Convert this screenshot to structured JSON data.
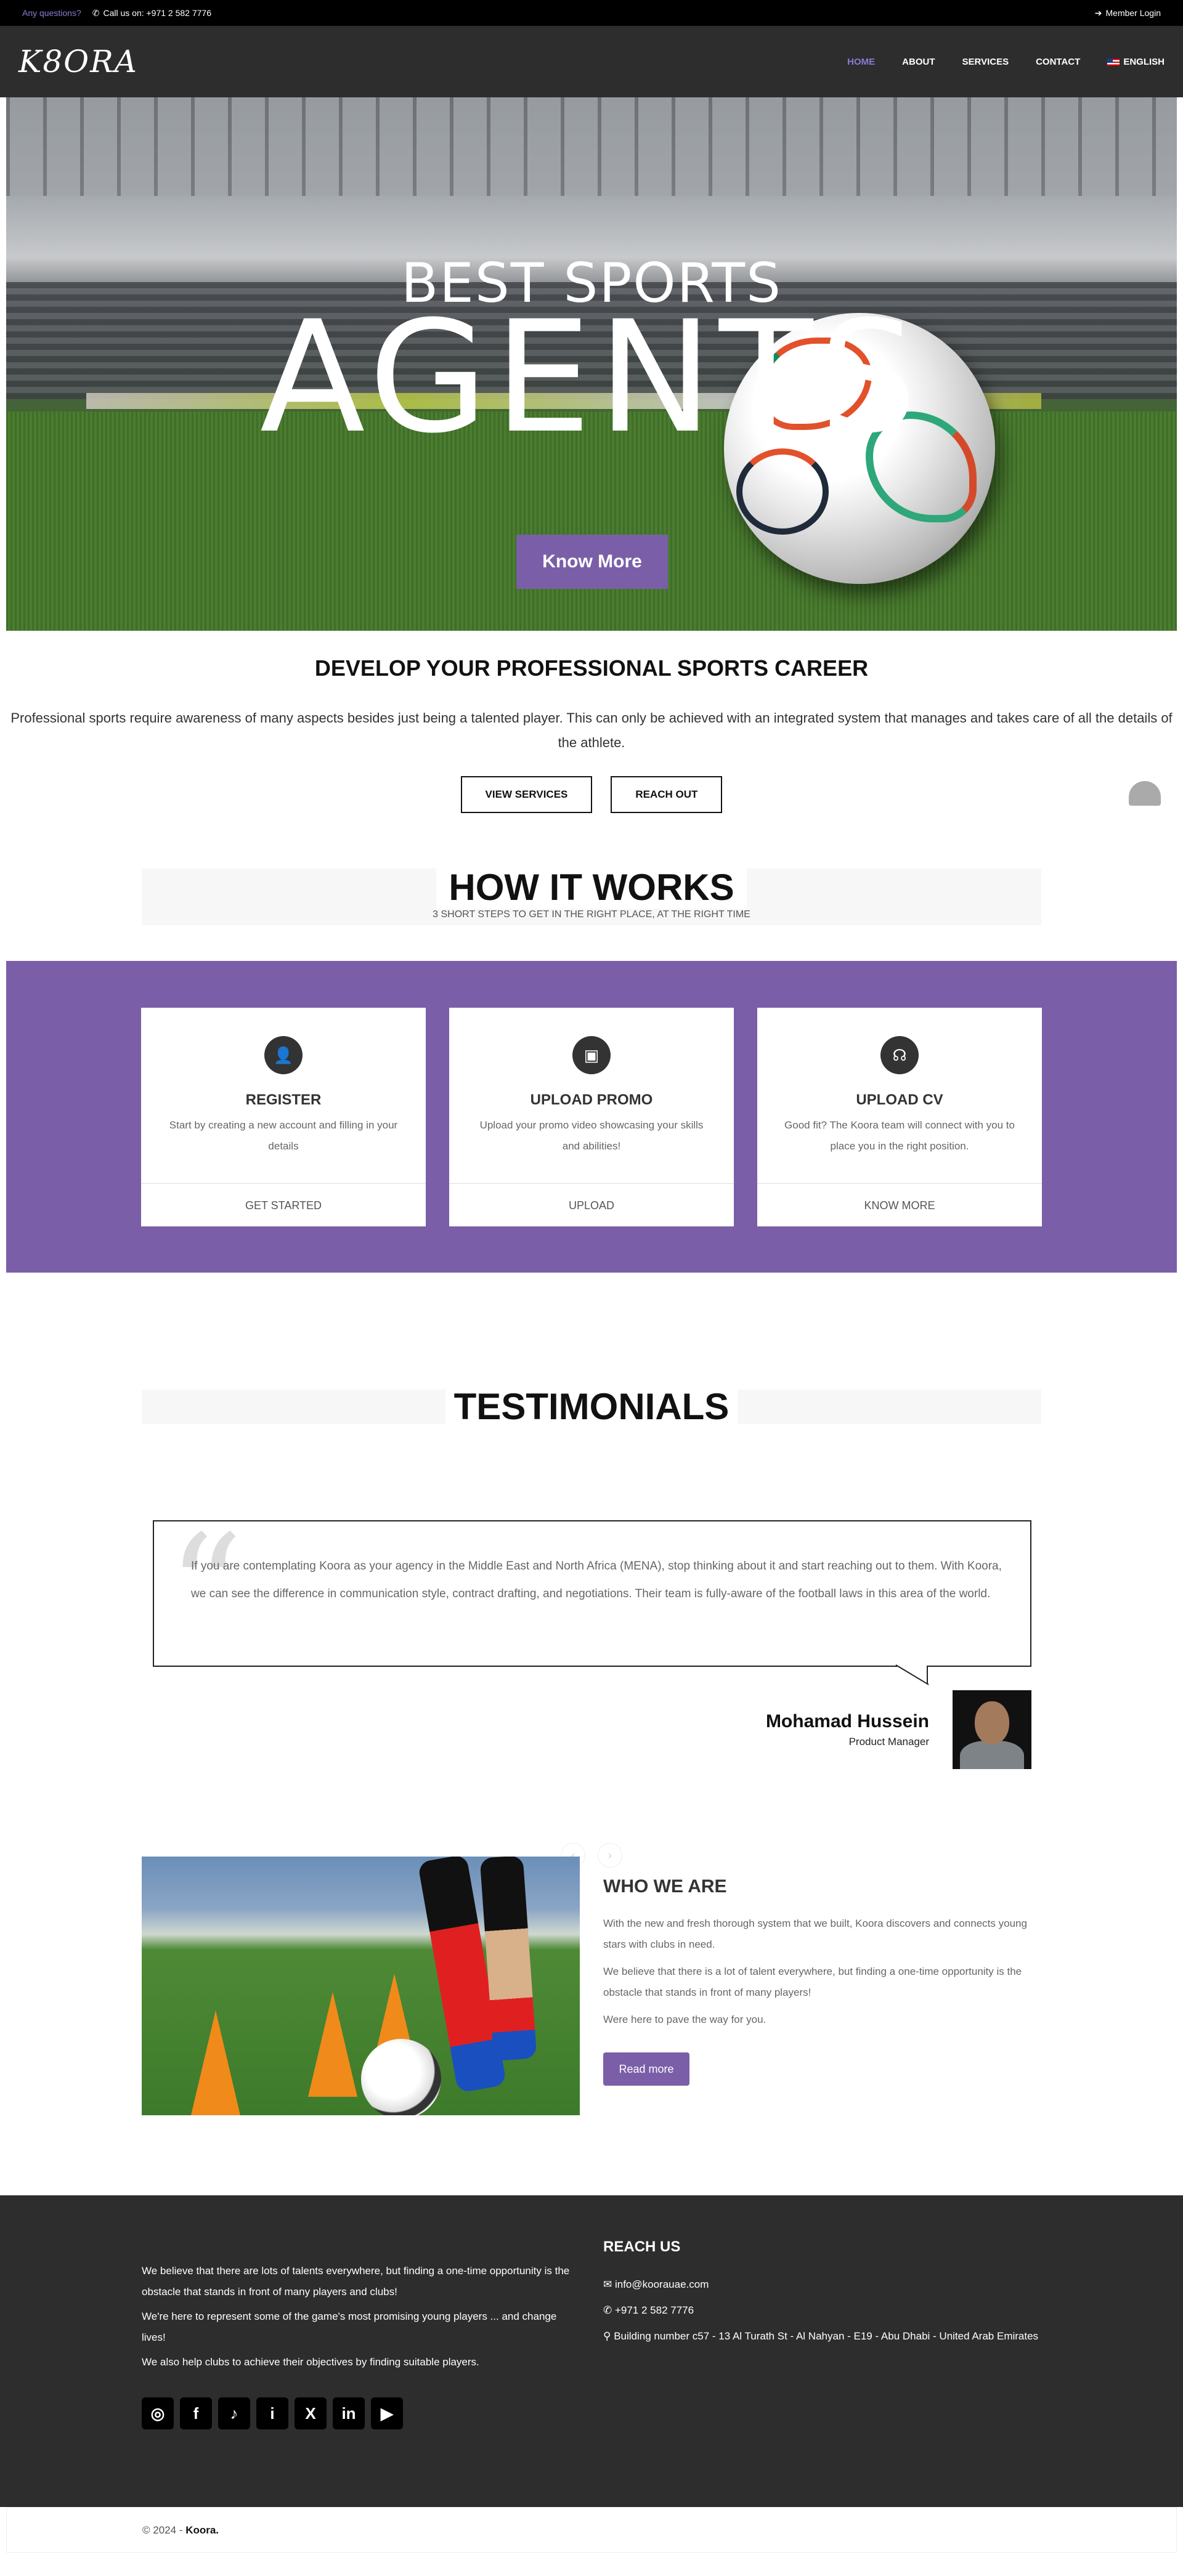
{
  "topbar": {
    "question": "Any questions?",
    "call": "Call us on: +971 2 582 7776",
    "member": "Member Login"
  },
  "header": {
    "logo": "K8ORA",
    "nav": [
      {
        "label": "HOME"
      },
      {
        "label": "ABOUT"
      },
      {
        "label": "SERVICES"
      },
      {
        "label": "CONTACT"
      },
      {
        "label": "ENGLISH"
      }
    ]
  },
  "hero": {
    "line1": "BEST SPORTS",
    "line2": "AGENTS",
    "button": "Know More"
  },
  "develop": {
    "title": "DEVELOP YOUR PROFESSIONAL SPORTS CAREER",
    "text": "Professional sports require awareness of many aspects besides just being a talented player. This can only be achieved with an integrated system that manages and takes care of all the details of the athlete.",
    "btn1": "VIEW SERVICES",
    "btn2": "REACH OUT"
  },
  "how": {
    "title": "HOW IT WORKS",
    "sub": "3 SHORT STEPS TO GET IN THE RIGHT PLACE, AT THE RIGHT TIME",
    "cards": [
      {
        "title": "REGISTER",
        "text": "Start by creating a new account and filling in your details",
        "foot": "GET STARTED"
      },
      {
        "title": "UPLOAD PROMO",
        "text": "Upload your promo video showcasing your skills and abilities!",
        "foot": "UPLOAD"
      },
      {
        "title": "UPLOAD CV",
        "text": "Good fit? The Koora team will connect with you to place you in the right position.",
        "foot": "KNOW MORE"
      }
    ]
  },
  "testimonials": {
    "title": "TESTIMONIALS",
    "quote": "If you are contemplating Koora as your agency in the Middle East and North Africa (MENA), stop thinking about it and start reaching out to them. With Koora, we can see the difference in communication style, contract drafting, and negotiations. Their team is fully-aware of the football laws in this area of the world.",
    "name": "Mohamad Hussein",
    "role": "Product Manager"
  },
  "who": {
    "title": "WHO WE ARE",
    "p1": "With the new and fresh thorough system that we built, Koora discovers and connects young stars with clubs in need.",
    "p2": "We believe that there is a lot of talent everywhere, but finding a one-time opportunity is the obstacle that stands in front of many players!",
    "p3": "Were here to pave the way for you.",
    "button": "Read more"
  },
  "footer": {
    "p1": "We believe that there are lots of talents everywhere, but finding a one-time opportunity is the obstacle that stands in front of many players and clubs!",
    "p2": "We're here to represent some of the game's most promising young players ... and change lives!",
    "p3": "We also help clubs to achieve their objectives by finding suitable players.",
    "reach_title": "REACH US",
    "email": "info@koorauae.com",
    "phone": "+971 2 582 7776",
    "address": "Building number c57 - 13 Al Turath St - Al Nahyan - E19 - Abu Dhabi - United Arab Emirates",
    "copyright": "© 2024 - ",
    "brand": "Koora."
  },
  "colors": {
    "accent": "#7a5fa8",
    "dark": "#2d2d2d"
  }
}
